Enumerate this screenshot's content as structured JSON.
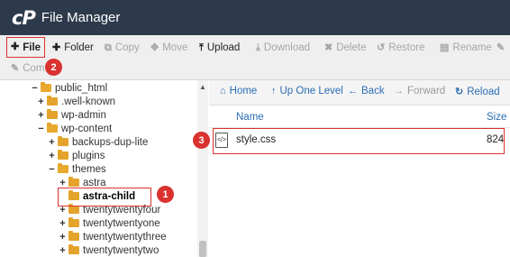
{
  "header": {
    "logo": "cP",
    "title": "File Manager"
  },
  "toolbar": {
    "file": "File",
    "folder": "Folder",
    "copy": "Copy",
    "move": "Move",
    "upload": "Upload",
    "download": "Download",
    "delete": "Delete",
    "restore": "Restore",
    "rename": "Rename",
    "compress": "Com"
  },
  "tree": {
    "items": [
      {
        "label": "public_html",
        "expander": "−"
      },
      {
        "label": ".well-known",
        "expander": "+"
      },
      {
        "label": "wp-admin",
        "expander": "+"
      },
      {
        "label": "wp-content",
        "expander": "−"
      },
      {
        "label": "backups-dup-lite",
        "expander": "+"
      },
      {
        "label": "plugins",
        "expander": "+"
      },
      {
        "label": "themes",
        "expander": "−"
      },
      {
        "label": "astra",
        "expander": "+"
      },
      {
        "label": "astra-child",
        "expander": ""
      },
      {
        "label": "twentytwentyfour",
        "expander": "+"
      },
      {
        "label": "twentytwentyone",
        "expander": "+"
      },
      {
        "label": "twentytwentythree",
        "expander": "+"
      },
      {
        "label": "twentytwentytwo",
        "expander": "+"
      }
    ]
  },
  "nav": {
    "home": "Home",
    "up": "Up One Level",
    "back": "Back",
    "forward": "Forward",
    "reload": "Reload"
  },
  "table": {
    "col_name": "Name",
    "col_size": "Size",
    "rows": [
      {
        "name": "style.css",
        "size": "824"
      }
    ]
  },
  "callouts": {
    "one": "1",
    "two": "2",
    "three": "3"
  },
  "colors": {
    "header_bg": "#2d3a4b",
    "accent": "#d9322f",
    "link": "#2a6db5",
    "folder": "#e4a32a"
  }
}
